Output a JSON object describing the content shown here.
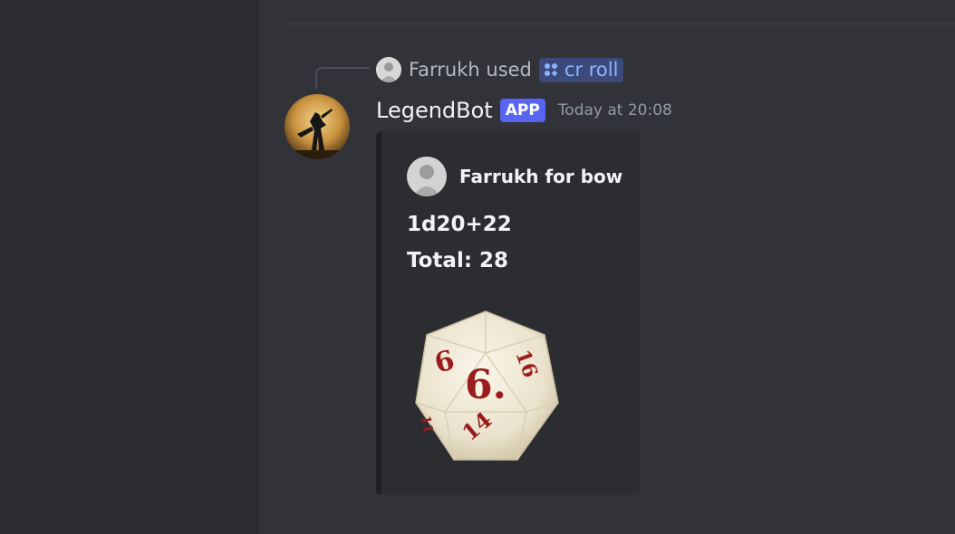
{
  "reply": {
    "user": "Farrukh",
    "used_text": "used",
    "command": "cr roll"
  },
  "message": {
    "bot_name": "LegendBot",
    "badge": "APP",
    "timestamp": "Today at 20:08"
  },
  "embed": {
    "author": "Farrukh for bow",
    "roll_expression": "1d20+22",
    "total": "Total: 28",
    "dice_faces": [
      "6",
      "6.",
      "16",
      "14",
      "11"
    ]
  },
  "colors": {
    "background": "#313338",
    "sidebar": "#2b2d31",
    "embed_bg": "#2b2d31",
    "app_badge": "#5865f2",
    "command_text": "#8fb4ff",
    "dice_numbers": "#9b1c1c"
  }
}
